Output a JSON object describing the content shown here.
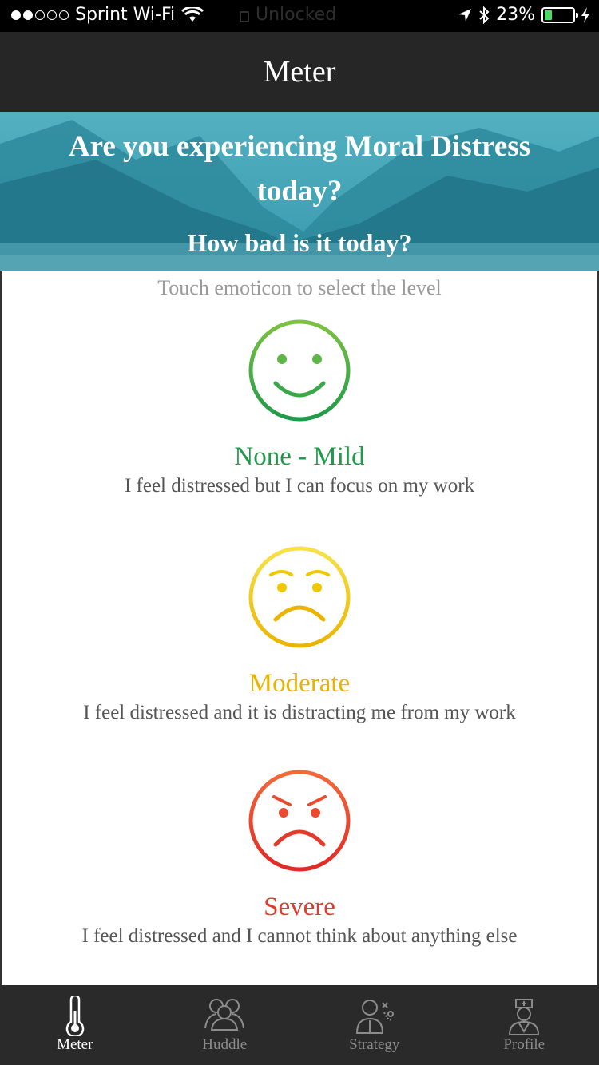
{
  "status_bar": {
    "carrier": "Sprint Wi-Fi",
    "center_text": "Unlocked",
    "battery_percent": "23%",
    "battery_level": 0.23,
    "signal_bars_filled": 2,
    "signal_bars_total": 5
  },
  "nav": {
    "title": "Meter"
  },
  "banner": {
    "question": "Are you experiencing Moral Distress today?",
    "subquestion": "How bad is it today?"
  },
  "main": {
    "hint": "Touch emoticon to select the level",
    "levels": [
      {
        "title": "None - Mild",
        "description": "I feel distressed but I can focus on my work",
        "color": "#1f9a4a",
        "icon": "smiley-face-icon"
      },
      {
        "title": "Moderate",
        "description": "I feel distressed and it is distracting me from my work",
        "color": "#e8b400",
        "icon": "worried-face-icon"
      },
      {
        "title": "Severe",
        "description": "I feel distressed and I cannot think about anything else",
        "color": "#e03b2b",
        "icon": "angry-face-icon"
      }
    ]
  },
  "tabs": [
    {
      "label": "Meter",
      "icon": "thermometer-icon",
      "active": true
    },
    {
      "label": "Huddle",
      "icon": "group-icon",
      "active": false
    },
    {
      "label": "Strategy",
      "icon": "strategy-person-icon",
      "active": false
    },
    {
      "label": "Profile",
      "icon": "nurse-profile-icon",
      "active": false
    }
  ]
}
